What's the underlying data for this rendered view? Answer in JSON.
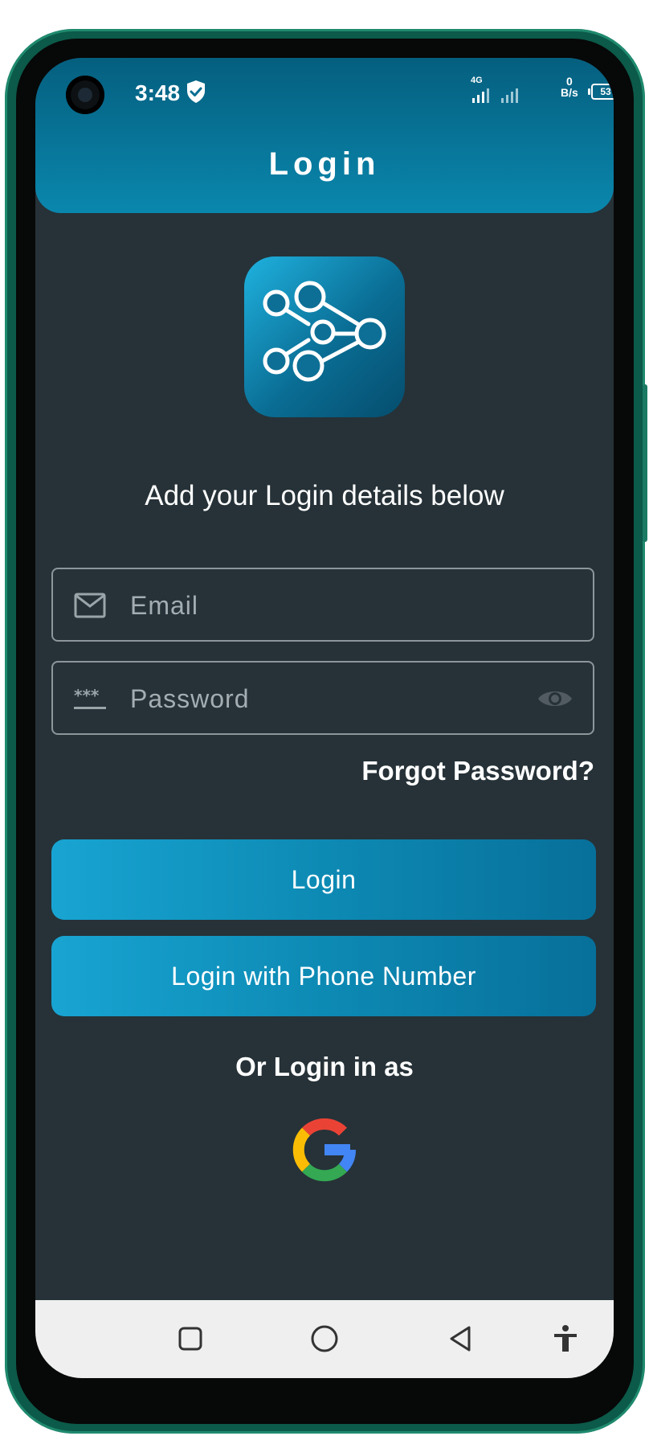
{
  "status_bar": {
    "time": "3:48",
    "network": "4G",
    "speed_value": "0",
    "speed_unit": "B/s",
    "battery": "53"
  },
  "header": {
    "title": "Login"
  },
  "tagline": "Add your Login details below",
  "form": {
    "email_placeholder": "Email",
    "password_placeholder": "Password",
    "forgot_password": "Forgot Password?"
  },
  "buttons": {
    "login": "Login",
    "phone_login": "Login with Phone Number"
  },
  "alt_login_label": "Or Login in as",
  "colors": {
    "header_dark": "#055f7f",
    "header_light": "#0a87ad",
    "background": "#263238",
    "button_start": "#18a4d2",
    "button_end": "#07709a"
  },
  "icons": {
    "status": [
      "shield-check-icon",
      "signal-icon",
      "battery-icon"
    ],
    "form": [
      "mail-icon",
      "password-dots-icon",
      "eye-icon"
    ],
    "social": [
      "google-icon"
    ],
    "nav": [
      "recent-apps-icon",
      "home-icon",
      "back-icon",
      "accessibility-icon"
    ]
  }
}
